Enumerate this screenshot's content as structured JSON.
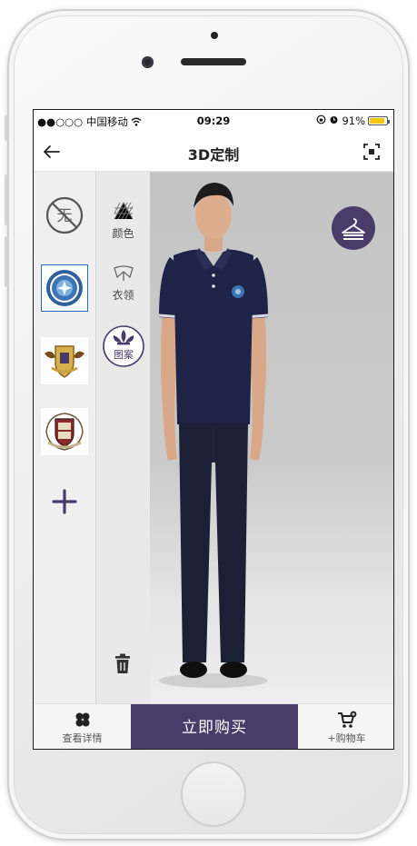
{
  "status_bar": {
    "carrier": "●●○○○ 中国移动",
    "time": "09:29",
    "battery_text": "91%",
    "battery_level": 0.91
  },
  "nav": {
    "title": "3D定制"
  },
  "options": {
    "color_label": "颜色",
    "collar_label": "衣领",
    "pattern_label": "图案"
  },
  "logos": [
    {
      "name": "none",
      "selected": false
    },
    {
      "name": "badge-blue-seal",
      "selected": true
    },
    {
      "name": "badge-gold-crest",
      "selected": false
    },
    {
      "name": "badge-shield-crest",
      "selected": false
    }
  ],
  "bottom": {
    "details_label": "查看详情",
    "buy_label": "立即购买",
    "cart_label": "+购物车"
  },
  "colors": {
    "accent": "#4a3c6a",
    "shirt": "#1e2347",
    "pants": "#1c2036"
  }
}
